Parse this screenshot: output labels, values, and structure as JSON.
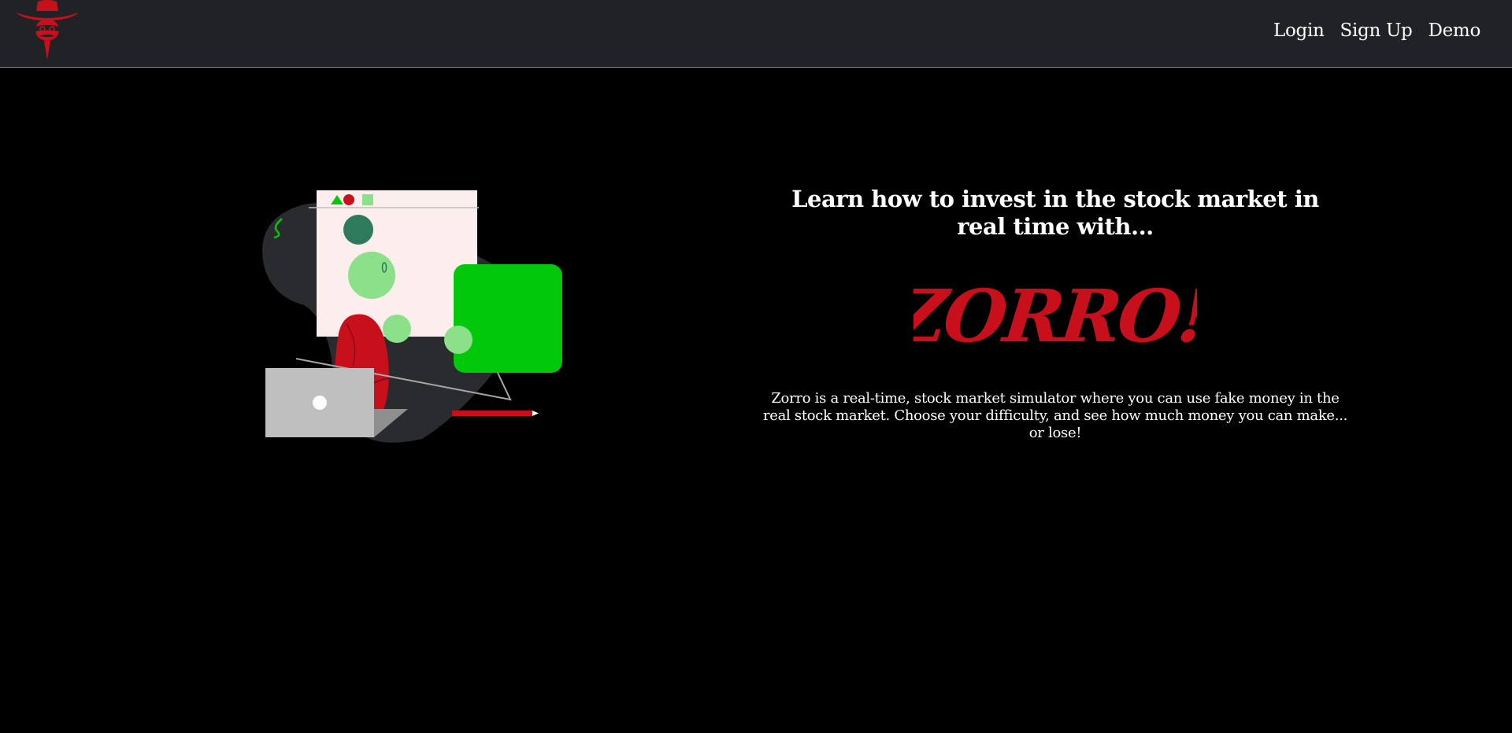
{
  "nav": {
    "logo_icon": "zorro-masked-hat-logo-icon",
    "links": [
      {
        "label": "Login"
      },
      {
        "label": "Sign Up"
      },
      {
        "label": "Demo"
      }
    ]
  },
  "hero": {
    "illustration_icon": "person-at-laptop-illustration",
    "headline": "Learn how to invest in the stock market in real time with...",
    "brand_wordmark": "ZORRO!",
    "description": "Zorro is a real-time, stock market simulator where you can use fake money in the real stock market. Choose your difficulty, and see how much money you can make... or lose!"
  },
  "colors": {
    "navbar_bg": "#212226",
    "page_bg": "#000000",
    "brand_red": "#c8101c",
    "accent_green": "#02c80b",
    "light_green": "#8ce08a",
    "dark_green": "#2d7a5d",
    "panel_pink": "#fdeeee"
  }
}
